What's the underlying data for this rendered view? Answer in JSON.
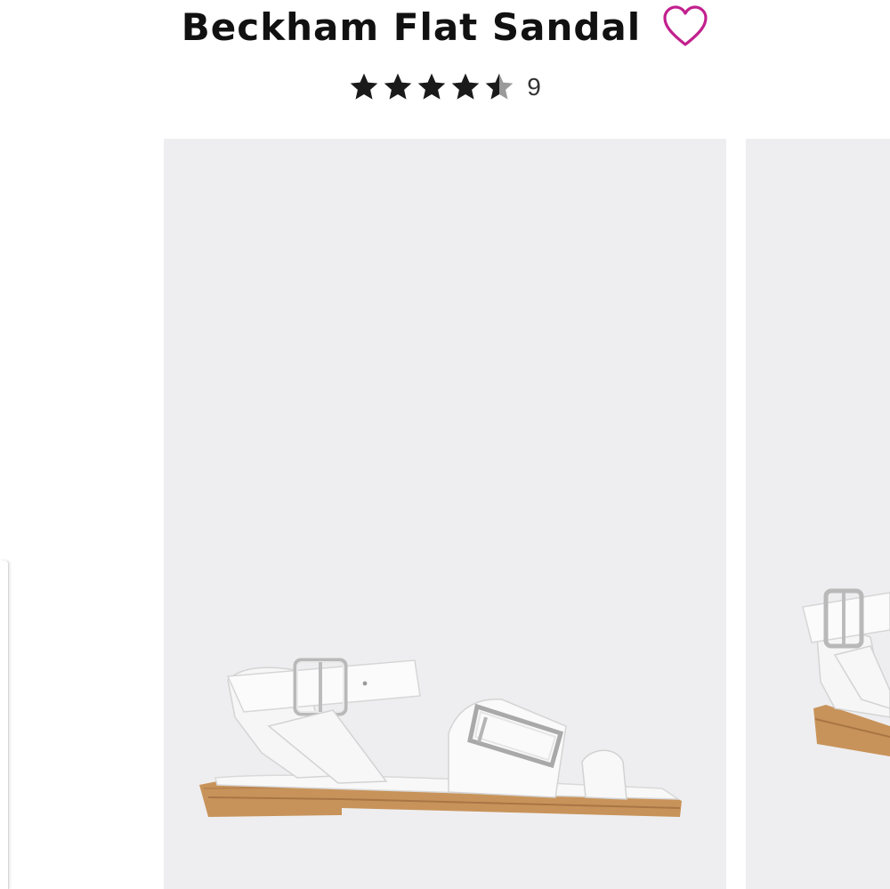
{
  "product": {
    "title": "Beckham Flat Sandal",
    "rating": 4.5,
    "rating_max": 5,
    "review_count": "9"
  },
  "icons": {
    "favorite": "heart-outline-icon",
    "star": "star-icon"
  },
  "colors": {
    "title": "#111111",
    "heart": "#c2208e",
    "star_filled": "#1a1a1a",
    "star_empty": "#9a9a9a",
    "image_bg": "#eeeef0",
    "sole": "#c8935a"
  },
  "gallery": {
    "images": [
      {
        "alt": "Beckham Flat Sandal side view"
      },
      {
        "alt": "Beckham Flat Sandal alternate view"
      }
    ]
  }
}
